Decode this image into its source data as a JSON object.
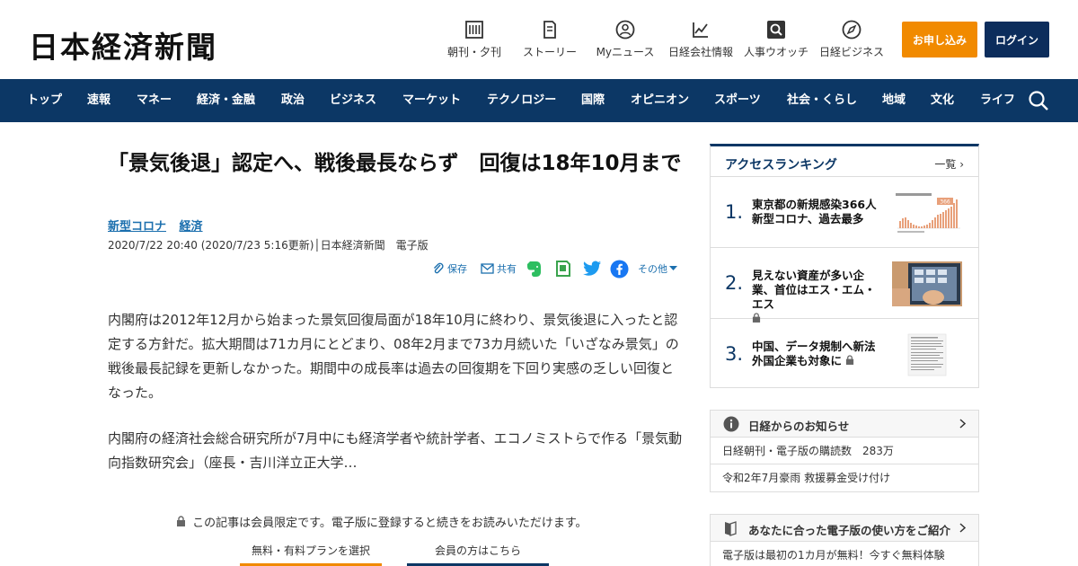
{
  "header": {
    "logo": "日本経済新聞",
    "nav": [
      {
        "label": "朝刊・夕刊",
        "icon": "newspaper-icon"
      },
      {
        "label": "ストーリー",
        "icon": "book-icon"
      },
      {
        "label": "Myニュース",
        "icon": "user-icon"
      },
      {
        "label": "日経会社情報",
        "icon": "chart-icon"
      },
      {
        "label": "人事ウオッチ",
        "icon": "magnifier-icon"
      },
      {
        "label": "日経ビジネス",
        "icon": "compass-icon"
      }
    ],
    "apply_label": "お申し込み",
    "login_label": "ログイン"
  },
  "navbar": {
    "items": [
      "トップ",
      "速報",
      "マネー",
      "経済・金融",
      "政治",
      "ビジネス",
      "マーケット",
      "テクノロジー",
      "国際",
      "オピニオン",
      "スポーツ",
      "社会・くらし",
      "地域",
      "文化",
      "ライフ"
    ]
  },
  "article": {
    "title": "「景気後退」認定へ、戦後最長ならず　回復は18年10月まで",
    "tags": [
      "新型コロナ",
      "経済"
    ],
    "meta": "2020/7/22 20:40 (2020/7/23 5:16更新)│日本経済新聞　電子版",
    "share": {
      "save": "保存",
      "share": "共有",
      "more": "その他"
    },
    "paragraphs": [
      "内閣府は2012年12月から始まった景気回復局面が18年10月に終わり、景気後退に入ったと認定する方針だ。拡大期間は71カ月にとどまり、08年2月まで73カ月続いた「いざなみ景気」の戦後最長記録を更新しなかった。期間中の成長率は過去の回復期を下回り実感の乏しい回復となった。",
      "内閣府の経済社会総合研究所が7月中にも経済学者や統計学者、エコノミストらで作る「景気動向指数研究会」（座長・吉川洋立正大学…"
    ],
    "locked_notice": "この記事は会員限定です。電子版に登録すると続きをお読みいただけます。",
    "plan_button": "無料・有料プランを選択",
    "member_button": "会員の方はこちら"
  },
  "sidebar": {
    "ranking": {
      "title": "アクセスランキング",
      "more": "一覧",
      "items": [
        {
          "num": "1.",
          "text": "東京都の新規感染366人　新型コロナ、過去最多",
          "locked": false
        },
        {
          "num": "2.",
          "text": "見えない資産が多い企業、首位はエス・エム・エス",
          "locked": true
        },
        {
          "num": "3.",
          "text": "中国、データ規制へ新法　外国企業も対象に",
          "locked": true
        }
      ]
    },
    "notice": {
      "title": "日経からのお知らせ",
      "rows": [
        "日経朝刊・電子版の購読数　283万",
        "令和2年7月豪雨 救援募金受け付け"
      ]
    },
    "guide": {
      "title": "あなたに合った電子版の使い方をご紹介",
      "rows": [
        "電子版は最初の1カ月が無料！今すぐ無料体験"
      ]
    },
    "thumb_texts": {
      "covid_chart": "366"
    }
  },
  "colors": {
    "navy": "#0c3765",
    "orange": "#f18a00",
    "link": "#1b6fae"
  }
}
